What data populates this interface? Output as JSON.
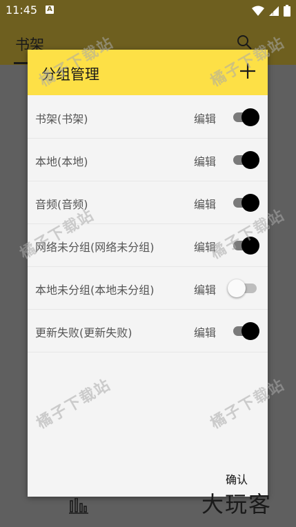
{
  "status_bar": {
    "time": "11:45",
    "notification_badge": "A"
  },
  "app_bar": {
    "title": "书架"
  },
  "dialog": {
    "title": "分组管理",
    "confirm_label": "确认",
    "groups": [
      {
        "name": "书架(书架)",
        "edit_label": "编辑",
        "enabled": true
      },
      {
        "name": "本地(本地)",
        "edit_label": "编辑",
        "enabled": true
      },
      {
        "name": "音频(音频)",
        "edit_label": "编辑",
        "enabled": true
      },
      {
        "name": "网络未分组(网络未分组)",
        "edit_label": "编辑",
        "enabled": true
      },
      {
        "name": "本地未分组(本地未分组)",
        "edit_label": "编辑",
        "enabled": false
      },
      {
        "name": "更新失败(更新失败)",
        "edit_label": "编辑",
        "enabled": true
      }
    ]
  },
  "watermark": {
    "site": "橘子下载站",
    "logo": "大玩客"
  },
  "colors": {
    "dialog_header": "#fde046",
    "app_bar": "#6e5f1f",
    "scrim": "#5f5f5f"
  }
}
